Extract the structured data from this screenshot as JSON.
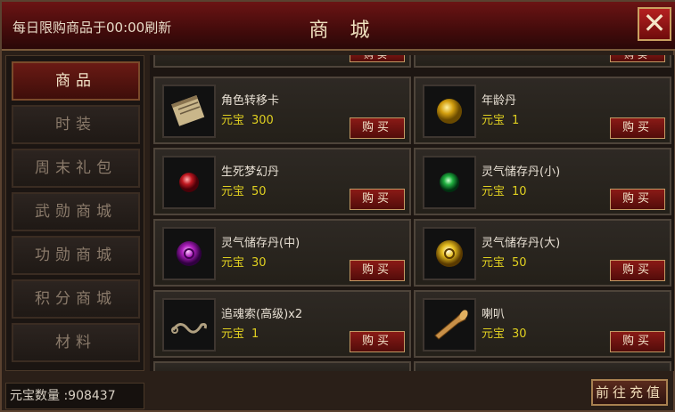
{
  "header": {
    "refresh_notice": "每日限购商品于00:00刷新",
    "title": "商城",
    "close_symbol": "✕"
  },
  "sidebar": {
    "items": [
      {
        "label": "商品",
        "active": true
      },
      {
        "label": "时装",
        "active": false
      },
      {
        "label": "周末礼包",
        "active": false
      },
      {
        "label": "武勋商城",
        "active": false
      },
      {
        "label": "功勋商城",
        "active": false
      },
      {
        "label": "积分商城",
        "active": false
      },
      {
        "label": "材料",
        "active": false
      }
    ]
  },
  "shop": {
    "currency_label": "元宝",
    "buy_label": "购买",
    "items": [
      {
        "name": "角色转移卡",
        "price": "300",
        "icon": "scroll-icon"
      },
      {
        "name": "年龄丹",
        "price": "1",
        "icon": "golden-pill-icon"
      },
      {
        "name": "生死梦幻丹",
        "price": "50",
        "icon": "red-pill-icon"
      },
      {
        "name": "灵气储存丹(小)",
        "price": "10",
        "icon": "green-orb-icon"
      },
      {
        "name": "灵气储存丹(中)",
        "price": "30",
        "icon": "purple-orb-icon"
      },
      {
        "name": "灵气储存丹(大)",
        "price": "50",
        "icon": "gold-orb-icon"
      },
      {
        "name": "追魂索(高级)x2",
        "price": "1",
        "icon": "rope-icon"
      },
      {
        "name": "喇叭",
        "price": "30",
        "icon": "horn-icon"
      }
    ]
  },
  "footer": {
    "balance_text": "元宝数量 :908437",
    "recharge_label": "前往充值"
  },
  "colors": {
    "title_bar": "#6b1414",
    "price": "#e0d020",
    "button": "#8a1a16"
  }
}
